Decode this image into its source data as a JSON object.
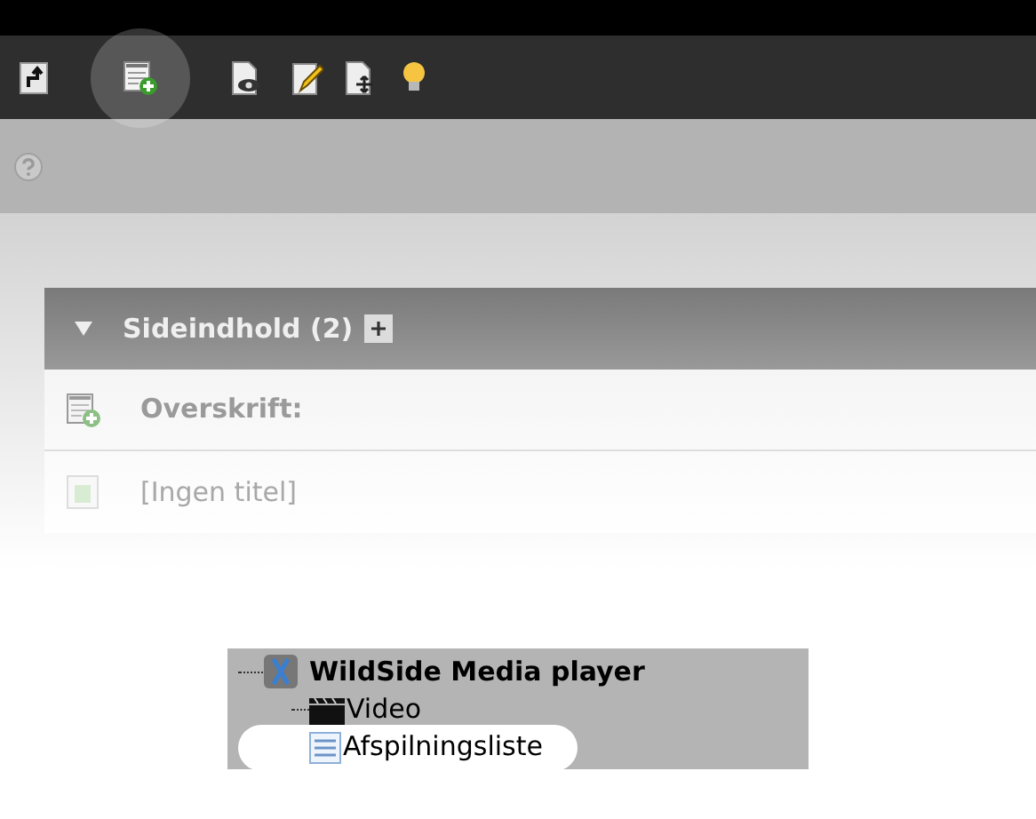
{
  "toolbar": {
    "buttons": [
      {
        "kind": "up",
        "highlighted": false
      },
      {
        "kind": "new-record",
        "highlighted": true
      },
      {
        "kind": "view",
        "highlighted": false
      },
      {
        "kind": "edit",
        "highlighted": false
      },
      {
        "kind": "move",
        "highlighted": false
      },
      {
        "kind": "tip",
        "highlighted": false
      }
    ]
  },
  "section": {
    "title": "Sideindhold (2)",
    "expanded": true,
    "rows": [
      {
        "kind": "heading",
        "label": "Overskrift:"
      },
      {
        "kind": "record",
        "label": "[Ingen titel]"
      }
    ]
  },
  "tree": {
    "label": "WildSide Media player",
    "children": [
      {
        "label": "Video",
        "kind": "video",
        "selected": false
      },
      {
        "label": "Afspilningsliste",
        "kind": "list",
        "selected": true
      }
    ]
  }
}
